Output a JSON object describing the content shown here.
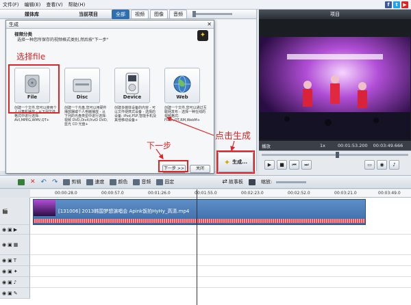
{
  "menu": [
    "文件(F)",
    "编辑(E)",
    "查看(V)",
    "帮助(H)"
  ],
  "social_icons": [
    "facebook-icon",
    "twitter-icon",
    "youtube-icon"
  ],
  "media_library": {
    "title": "媒体库",
    "current_project": "当前项目",
    "tabs": [
      "全部",
      "视频",
      "图像",
      "音频"
    ]
  },
  "preview": {
    "title": "项目",
    "state": "播放",
    "speed": "1x",
    "time_current": "00:01:53.200",
    "time_total": "00:03:49.666"
  },
  "dialog": {
    "title": "生成",
    "section": "视频分类",
    "description": "选择一种您所保存的视频格式类别,然后按\"下一步\"",
    "cards": [
      {
        "label": "File",
        "icon": "hard-drive-icon",
        "desc": "创建一个文件,您可以使用个人计算机播放 - 从下列文件格式中进行选择: AVI,MPEG,WMV,QT+"
      },
      {
        "label": "Disc",
        "icon": "disc-icon",
        "desc": "创建一个光盘,您可以用硬件播放器或个人电脑播放 - 从下列的光盘类型中进行选择: 视频 DVD,DivX/XviD DVD,蓝光 CD 光盘+"
      },
      {
        "label": "Device",
        "icon": "ipod-icon",
        "desc": "创建多媒体设备的内容 - 可以文件便携式设备 - 选择的设备: iPod,PSP,智能手机及其他移动设备+"
      },
      {
        "label": "Web",
        "icon": "globe-icon",
        "desc": "创建一个文件,您可以通过互联网发布 - 选择一种在线的视频格式: Flash,QT,RM,WebM+"
      }
    ],
    "next_button": "下一步 >>",
    "close_button": "关闭"
  },
  "generate_button": "生成...",
  "annotations": {
    "select_file": "选择file",
    "next_step": "下一步",
    "click_generate": "点击生成"
  },
  "timeline_toolbar": [
    {
      "label": "",
      "icon": "import-icon"
    },
    {
      "label": "",
      "icon": "delete-icon"
    },
    {
      "label": "",
      "icon": "undo-icon"
    },
    {
      "label": "",
      "icon": "redo-icon"
    },
    {
      "label": "剪辑",
      "icon": "cut-icon"
    },
    {
      "label": "速度",
      "icon": "speed-icon"
    },
    {
      "label": "颜色",
      "icon": "color-icon"
    },
    {
      "label": "音频",
      "icon": "audio-icon"
    },
    {
      "label": "固定",
      "icon": "stabilize-icon"
    }
  ],
  "storyboard": "故事板",
  "zoom_label": "缩放:",
  "ruler_ticks": [
    "00:00:28.0",
    "00:00:57.0",
    "00:01:26.0",
    "00:01:55.0",
    "00:02:23.0",
    "00:02:52.0",
    "00:03:21.0",
    "00:03:49.0"
  ],
  "clip": {
    "label": "[131006] 2013韩国梦想演唱会 Apink饭拍HyHy_高清.mp4"
  },
  "colors": {
    "accent": "#2f6fb0",
    "annotation": "#e02424",
    "clip": "#4a7bb7"
  }
}
